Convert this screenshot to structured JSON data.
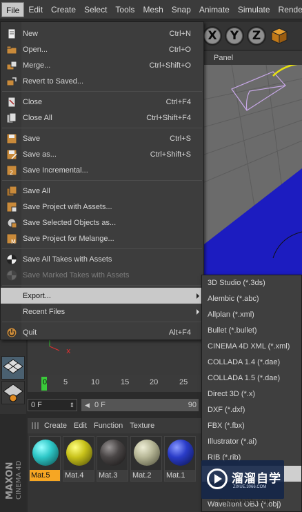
{
  "menubar": {
    "items": [
      "File",
      "Edit",
      "Create",
      "Select",
      "Tools",
      "Mesh",
      "Snap",
      "Animate",
      "Simulate",
      "Rende"
    ]
  },
  "toolbar": {
    "axis_x": "X",
    "axis_y": "Y",
    "axis_z": "Z",
    "cube_icon": "cube-coordinate-icon"
  },
  "viewport": {
    "panel_label": "Panel"
  },
  "file_menu": {
    "items": [
      {
        "label": "New",
        "shortcut": "Ctrl+N",
        "icon": "new-file-icon"
      },
      {
        "label": "Open...",
        "shortcut": "Ctrl+O",
        "icon": "open-folder-icon"
      },
      {
        "label": "Merge...",
        "shortcut": "Ctrl+Shift+O",
        "icon": "merge-icon"
      },
      {
        "label": "Revert to Saved...",
        "shortcut": "",
        "icon": "revert-icon"
      },
      {
        "label": "Close",
        "shortcut": "Ctrl+F4",
        "icon": "close-file-icon"
      },
      {
        "label": "Close All",
        "shortcut": "Ctrl+Shift+F4",
        "icon": "close-all-icon"
      },
      {
        "label": "Save",
        "shortcut": "Ctrl+S",
        "icon": "save-icon"
      },
      {
        "label": "Save as...",
        "shortcut": "Ctrl+Shift+S",
        "icon": "save-as-icon"
      },
      {
        "label": "Save Incremental...",
        "shortcut": "",
        "icon": "save-incremental-icon"
      },
      {
        "label": "Save All",
        "shortcut": "",
        "icon": "save-all-icon"
      },
      {
        "label": "Save Project with Assets...",
        "shortcut": "",
        "icon": "save-project-icon"
      },
      {
        "label": "Save Selected Objects as...",
        "shortcut": "",
        "icon": "save-selected-icon"
      },
      {
        "label": "Save Project for Melange...",
        "shortcut": "",
        "icon": "save-melange-icon"
      },
      {
        "label": "Save All Takes with Assets",
        "shortcut": "",
        "icon": "save-takes-icon"
      },
      {
        "label": "Save Marked Takes with Assets",
        "shortcut": "",
        "icon": "save-marked-takes-icon"
      },
      {
        "label": "Export...",
        "shortcut": "",
        "icon": ""
      },
      {
        "label": "Recent Files",
        "shortcut": "",
        "icon": ""
      },
      {
        "label": "Quit",
        "shortcut": "Alt+F4",
        "icon": "power-icon"
      }
    ]
  },
  "export_menu": {
    "items": [
      "3D Studio (*.3ds)",
      "Alembic (*.abc)",
      "Allplan (*.xml)",
      "Bullet (*.bullet)",
      "CINEMA 4D XML (*.xml)",
      "COLLADA 1.4 (*.dae)",
      "COLLADA 1.5 (*.dae)",
      "Direct 3D (*.x)",
      "DXF (*.dxf)",
      "FBX (*.fbx)",
      "Illustrator (*.ai)",
      "RIB (*.rib)",
      "",
      "",
      "Wavefront OBJ (*.obj)"
    ]
  },
  "timeline": {
    "ticks": [
      "0",
      "5",
      "10",
      "15",
      "20",
      "25"
    ],
    "current_frame": "0 F",
    "start_frame": "0 F",
    "end_frame": "90"
  },
  "material_manager": {
    "menu": [
      "Create",
      "Edit",
      "Function",
      "Texture"
    ],
    "materials": [
      {
        "name": "Mat.5",
        "color": "#2ec8c8",
        "selected": true
      },
      {
        "name": "Mat.4",
        "color": "#c8c21a",
        "selected": false
      },
      {
        "name": "Mat.3",
        "color": "#4a4646",
        "selected": false
      },
      {
        "name": "Mat.2",
        "color": "#b6b696",
        "selected": false
      },
      {
        "name": "Mat.1",
        "color": "#2a3cc8",
        "selected": false
      }
    ]
  },
  "branding": {
    "maxon": "MAXON",
    "cinema": "CINEMA 4D"
  },
  "watermark": {
    "title": "溜溜自学",
    "subtitle": "ZIXUE.3066.COM",
    "url": "jingyan.baidu.com"
  }
}
